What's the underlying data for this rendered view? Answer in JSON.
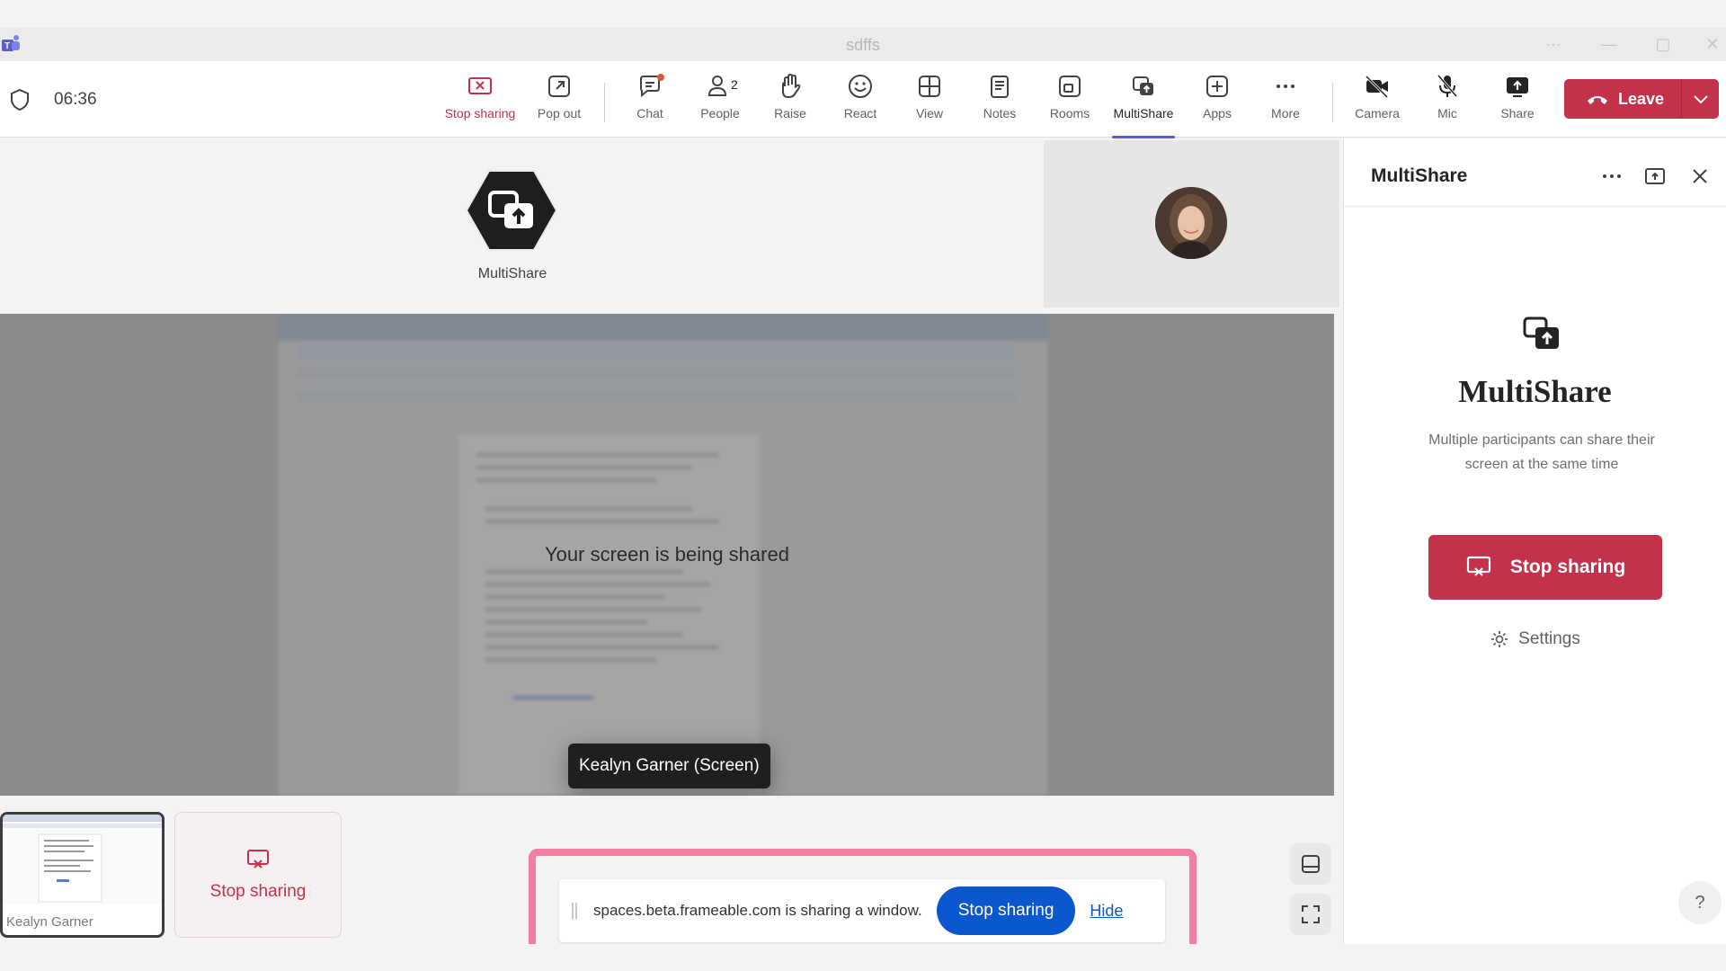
{
  "window": {
    "title": "sdffs"
  },
  "toolbar": {
    "timer": "06:36",
    "buttons": {
      "stop_sharing": "Stop sharing",
      "pop_out": "Pop out",
      "chat": "Chat",
      "people": "People",
      "people_count": "2",
      "raise": "Raise",
      "react": "React",
      "view": "View",
      "notes": "Notes",
      "rooms": "Rooms",
      "multishare": "MultiShare",
      "apps": "Apps",
      "more": "More",
      "camera": "Camera",
      "mic": "Mic",
      "share": "Share"
    },
    "leave_label": "Leave",
    "colors": {
      "accent": "#5b5fc7",
      "danger": "#c4314b"
    }
  },
  "stage": {
    "multishare_tile_label": "MultiShare",
    "screen_message": "Your screen is being shared",
    "name_tag": "Kealyn Garner (Screen)",
    "thumbnail_label": "Kealyn Garner",
    "stop_tile_label": "Stop sharing"
  },
  "share_bar": {
    "message": "spaces.beta.frameable.com is sharing a window.",
    "stop_label": "Stop sharing",
    "hide_label": "Hide",
    "colors": {
      "button": "#0b57d0",
      "highlight": "#f27ea0"
    }
  },
  "panel": {
    "title": "MultiShare",
    "heading": "MultiShare",
    "description": "Multiple participants can share their screen at the same time",
    "stop_label": "Stop sharing",
    "settings_label": "Settings",
    "help_label": "?"
  }
}
